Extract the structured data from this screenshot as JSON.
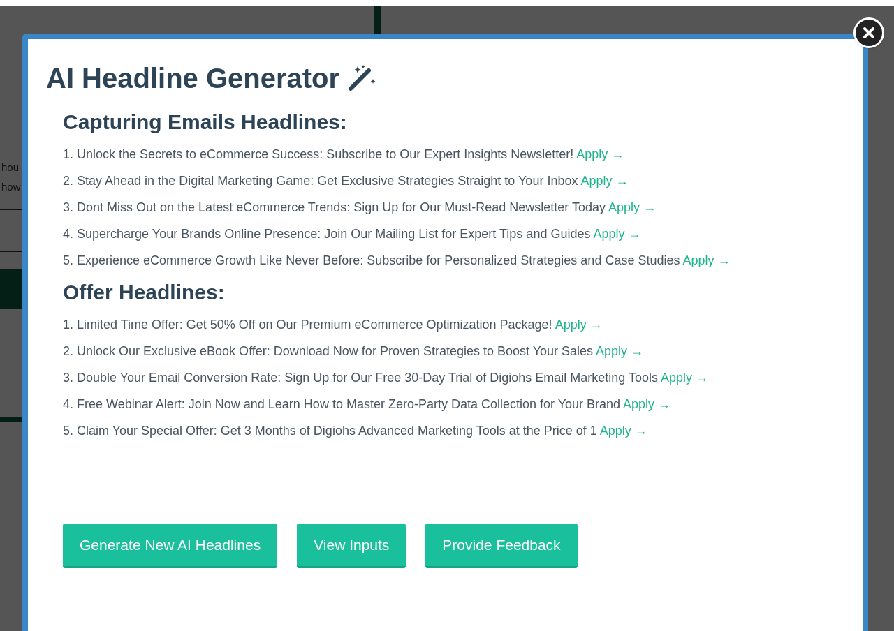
{
  "background_page": {
    "fragments": [
      "hou",
      "how"
    ]
  },
  "modal": {
    "title": "AI Headline Generator",
    "sections": [
      {
        "heading": "Capturing Emails Headlines:",
        "items": [
          {
            "number": "1.",
            "text": "Unlock the Secrets to eCommerce Success: Subscribe to Our Expert Insights Newsletter!",
            "link": "Apply →"
          },
          {
            "number": "2.",
            "text": "Stay Ahead in the Digital Marketing Game: Get Exclusive Strategies Straight to Your Inbox",
            "link": "Apply →"
          },
          {
            "number": "3.",
            "text": "Dont Miss Out on the Latest eCommerce Trends: Sign Up for Our Must-Read Newsletter Today",
            "link": "Apply →"
          },
          {
            "number": "4.",
            "text": "Supercharge Your Brands Online Presence: Join Our Mailing List for Expert Tips and Guides",
            "link": "Apply →"
          },
          {
            "number": "5.",
            "text": "Experience eCommerce Growth Like Never Before: Subscribe for Personalized Strategies and Case Studies",
            "link": "Apply →"
          }
        ]
      },
      {
        "heading": "Offer Headlines:",
        "items": [
          {
            "number": "1.",
            "text": "Limited Time Offer: Get 50% Off on Our Premium eCommerce Optimization Package!",
            "link": "Apply →"
          },
          {
            "number": "2.",
            "text": "Unlock Our Exclusive eBook Offer: Download Now for Proven Strategies to Boost Your Sales",
            "link": "Apply →"
          },
          {
            "number": "3.",
            "text": "Double Your Email Conversion Rate: Sign Up for Our Free 30-Day Trial of Digiohs Email Marketing Tools",
            "link": "Apply →"
          },
          {
            "number": "4.",
            "text": "Free Webinar Alert: Join Now and Learn How to Master Zero-Party Data Collection for Your Brand",
            "link": "Apply →"
          },
          {
            "number": "5.",
            "text": "Claim Your Special Offer: Get 3 Months of Digiohs Advanced Marketing Tools at the Price of 1",
            "link": "Apply →"
          }
        ]
      }
    ],
    "buttons": [
      "Generate New AI Headlines",
      "View Inputs",
      "Provide Feedback"
    ]
  }
}
